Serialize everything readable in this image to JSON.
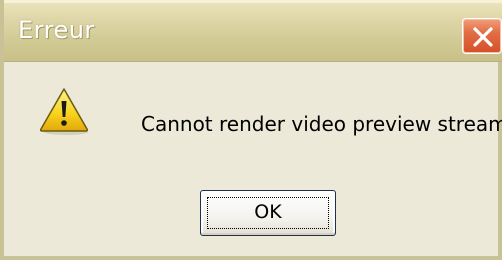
{
  "dialog": {
    "title": "Erreur",
    "message": "Cannot render video preview stream",
    "ok_label": "OK",
    "icon": "warning-icon",
    "close_icon": "close-icon"
  },
  "colors": {
    "titlebar": "#d6cf9e",
    "body": "#ece9d8",
    "close_button": "#e06a40",
    "warning_yellow": "#f7d11b"
  }
}
